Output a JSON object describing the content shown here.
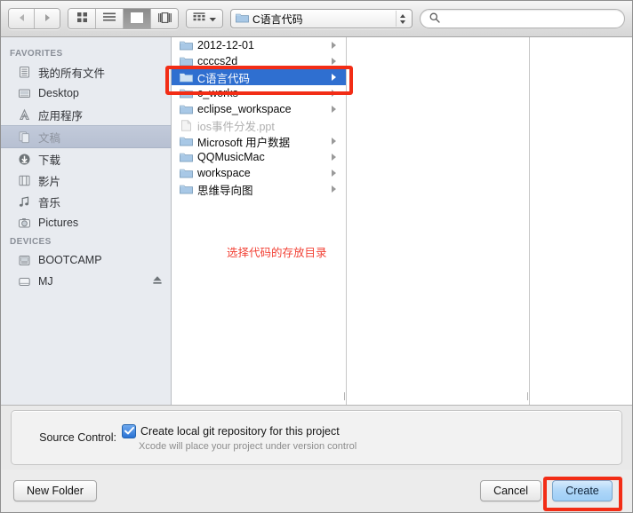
{
  "toolbar": {
    "back_icon": "chevron-left-icon",
    "forward_icon": "chevron-right-icon",
    "view_modes": [
      {
        "name": "icon-view",
        "icon": "grid-icon",
        "selected": false
      },
      {
        "name": "list-view",
        "icon": "list-icon",
        "selected": false
      },
      {
        "name": "column-view",
        "icon": "columns-icon",
        "selected": true
      },
      {
        "name": "coverflow-view",
        "icon": "coverflow-icon",
        "selected": false
      }
    ],
    "action_menu": {
      "icon": "gear-grid-icon",
      "chevron": "chevron-down-icon"
    },
    "path_popup": {
      "label": "C语言代码",
      "icon": "folder-icon"
    },
    "search": {
      "placeholder": "",
      "value": "",
      "icon": "search-icon"
    }
  },
  "sidebar": {
    "sections": [
      {
        "title": "FAVORITES",
        "items": [
          {
            "label": "我的所有文件",
            "icon": "all-my-files-icon",
            "selected": false
          },
          {
            "label": "Desktop",
            "icon": "desktop-icon",
            "selected": false
          },
          {
            "label": "应用程序",
            "icon": "applications-icon",
            "selected": false
          },
          {
            "label": "文稿",
            "icon": "documents-icon",
            "selected": true
          },
          {
            "label": "下载",
            "icon": "downloads-icon",
            "selected": false
          },
          {
            "label": "影片",
            "icon": "movies-icon",
            "selected": false
          },
          {
            "label": "音乐",
            "icon": "music-icon",
            "selected": false
          },
          {
            "label": "Pictures",
            "icon": "pictures-icon",
            "selected": false
          }
        ]
      },
      {
        "title": "DEVICES",
        "items": [
          {
            "label": "BOOTCAMP",
            "icon": "internal-drive-icon",
            "selected": false
          },
          {
            "label": "MJ",
            "icon": "external-drive-icon",
            "selected": false,
            "eject": true
          }
        ]
      }
    ]
  },
  "file_list": {
    "items": [
      {
        "name": "2012-12-01",
        "type": "folder",
        "selected": false,
        "disabled": false,
        "has_children": true
      },
      {
        "name": "ccccs2d",
        "type": "folder",
        "selected": false,
        "disabled": false,
        "has_children": true,
        "obscured": true
      },
      {
        "name": "C语言代码",
        "type": "folder",
        "selected": true,
        "disabled": false,
        "has_children": true
      },
      {
        "name": "c_works",
        "type": "folder",
        "selected": false,
        "disabled": false,
        "has_children": true,
        "obscured": true
      },
      {
        "name": "eclipse_workspace",
        "type": "folder",
        "selected": false,
        "disabled": false,
        "has_children": true
      },
      {
        "name": "ios事件分发.ppt",
        "type": "file",
        "selected": false,
        "disabled": true,
        "has_children": false
      },
      {
        "name": "Microsoft 用户数据",
        "type": "folder",
        "selected": false,
        "disabled": false,
        "has_children": true
      },
      {
        "name": "QQMusicMac",
        "type": "folder",
        "selected": false,
        "disabled": false,
        "has_children": true
      },
      {
        "name": "workspace",
        "type": "folder",
        "selected": false,
        "disabled": false,
        "has_children": true
      },
      {
        "name": "思维导向图",
        "type": "folder",
        "selected": false,
        "disabled": false,
        "has_children": true
      }
    ]
  },
  "annotations": {
    "note_text": "选择代码的存放目录",
    "color": "#f24236",
    "box_color": "#f22d16"
  },
  "source_control": {
    "label": "Source Control:",
    "checkbox_label": "Create local git repository for this project",
    "checked": true,
    "sub_label": "Xcode will place your project under version control"
  },
  "footer": {
    "new_folder_label": "New Folder",
    "cancel_label": "Cancel",
    "create_label": "Create"
  },
  "colors": {
    "selection_blue": "#2f6fd0",
    "sidebar_bg": "#e8ebf0",
    "annotation_red": "#f22d16"
  }
}
